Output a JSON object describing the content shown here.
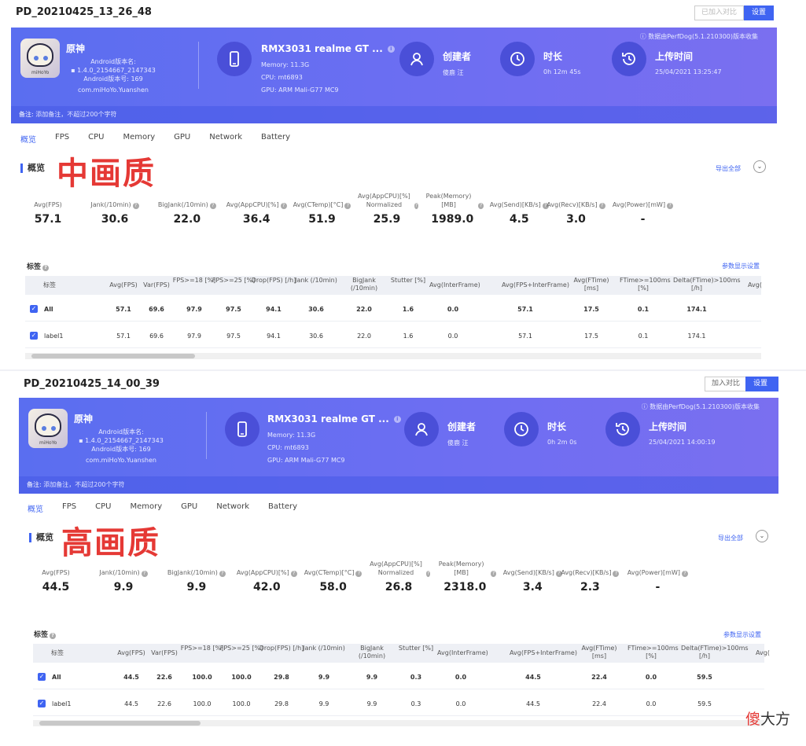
{
  "sessions": [
    {
      "title": "PD_20210425_13_26_48",
      "compare_btn": "已加入对比",
      "settings_btn": "设置",
      "source": "ⓘ 数据由PerfDog(5.1.210300)版本收集",
      "app": {
        "name": "原神",
        "version_label": "Android版本名:",
        "version": "1.4.0_2154667_2147343",
        "version_code": "Android版本号: 169",
        "package": "com.miHoYo.Yuanshen",
        "icon_text": "miHoYo"
      },
      "device": {
        "name": "RMX3031 realme GT ...",
        "memory": "Memory: 11.3G",
        "cpu": "CPU: mt6893",
        "gpu": "GPU: ARM Mali-G77 MC9"
      },
      "creator_label": "创建者",
      "creator": "傻鹿 汪",
      "duration_label": "时长",
      "duration": "0h 12m 45s",
      "upload_label": "上传时间",
      "upload": "25/04/2021 13:25:47",
      "note_label": "备注:",
      "note_placeholder": "添加备注，不超过200个字符",
      "tabs": [
        "概览",
        "FPS",
        "CPU",
        "Memory",
        "GPU",
        "Network",
        "Battery"
      ],
      "overview": "概览",
      "watermark": "中画质",
      "export": "导出全部",
      "metrics": [
        {
          "label": "Avg(FPS)",
          "value": "57.1"
        },
        {
          "label": "Jank(/10min)",
          "value": "30.6"
        },
        {
          "label": "BigJank(/10min)",
          "value": "22.0"
        },
        {
          "label": "Avg(AppCPU)[%]",
          "value": "36.4"
        },
        {
          "label": "Avg(CTemp)[°C]",
          "value": "51.9"
        },
        {
          "label": "Avg(AppCPU)[%] Normalized",
          "value": "25.9"
        },
        {
          "label": "Peak(Memory)[MB]",
          "value": "1989.0"
        },
        {
          "label": "Avg(Send)[KB/s]",
          "value": "4.5"
        },
        {
          "label": "Avg(Recv)[KB/s]",
          "value": "3.0"
        },
        {
          "label": "Avg(Power)[mW]",
          "value": "-"
        }
      ],
      "tags_label": "标签",
      "param_link": "参数显示设置",
      "columns": [
        "标签",
        "Avg(FPS)",
        "Var(FPS)",
        "FPS>=18 [%]",
        "FPS>=25 [%]",
        "Drop(FPS) [/h]",
        "Jank (/10min)",
        "BigJank (/10min)",
        "Stutter [%]",
        "Avg(InterFrame)",
        "Avg(FPS+InterFrame)",
        "Avg(FTime) [ms]",
        "FTime>=100ms [%]",
        "Delta(FTime)>100ms [/h]",
        "Avg("
      ],
      "rows": [
        {
          "label": "All",
          "vals": [
            "57.1",
            "69.6",
            "97.9",
            "97.5",
            "94.1",
            "30.6",
            "22.0",
            "1.6",
            "0.0",
            "57.1",
            "17.5",
            "0.1",
            "174.1"
          ]
        },
        {
          "label": "label1",
          "vals": [
            "57.1",
            "69.6",
            "97.9",
            "97.5",
            "94.1",
            "30.6",
            "22.0",
            "1.6",
            "0.0",
            "57.1",
            "17.5",
            "0.1",
            "174.1"
          ]
        }
      ]
    },
    {
      "title": "PD_20210425_14_00_39",
      "compare_btn": "加入对比",
      "settings_btn": "设置",
      "source": "ⓘ 数据由PerfDog(5.1.210300)版本收集",
      "app": {
        "name": "原神",
        "version_label": "Android版本名:",
        "version": "1.4.0_2154667_2147343",
        "version_code": "Android版本号: 169",
        "package": "com.miHoYo.Yuanshen",
        "icon_text": "miHoYo"
      },
      "device": {
        "name": "RMX3031 realme GT ...",
        "memory": "Memory: 11.3G",
        "cpu": "CPU: mt6893",
        "gpu": "GPU: ARM Mali-G77 MC9"
      },
      "creator_label": "创建者",
      "creator": "傻鹿 汪",
      "duration_label": "时长",
      "duration": "0h 2m 0s",
      "upload_label": "上传时间",
      "upload": "25/04/2021 14:00:19",
      "note_label": "备注:",
      "note_placeholder": "添加备注，不超过200个字符",
      "tabs": [
        "概览",
        "FPS",
        "CPU",
        "Memory",
        "GPU",
        "Network",
        "Battery"
      ],
      "overview": "概览",
      "watermark": "高画质",
      "export": "导出全部",
      "metrics": [
        {
          "label": "Avg(FPS)",
          "value": "44.5"
        },
        {
          "label": "Jank(/10min)",
          "value": "9.9"
        },
        {
          "label": "BigJank(/10min)",
          "value": "9.9"
        },
        {
          "label": "Avg(AppCPU)[%]",
          "value": "42.0"
        },
        {
          "label": "Avg(CTemp)[°C]",
          "value": "58.0"
        },
        {
          "label": "Avg(AppCPU)[%] Normalized",
          "value": "26.8"
        },
        {
          "label": "Peak(Memory)[MB]",
          "value": "2318.0"
        },
        {
          "label": "Avg(Send)[KB/s]",
          "value": "3.4"
        },
        {
          "label": "Avg(Recv)[KB/s]",
          "value": "2.3"
        },
        {
          "label": "Avg(Power)[mW]",
          "value": "-"
        }
      ],
      "tags_label": "标签",
      "param_link": "参数显示设置",
      "columns": [
        "标签",
        "Avg(FPS)",
        "Var(FPS)",
        "FPS>=18 [%]",
        "FPS>=25 [%]",
        "Drop(FPS) [/h]",
        "Jank (/10min)",
        "BigJank (/10min)",
        "Stutter [%]",
        "Avg(InterFrame)",
        "Avg(FPS+InterFrame)",
        "Avg(FTime) [ms]",
        "FTime>=100ms [%]",
        "Delta(FTime)>100ms [/h]",
        "Avg("
      ],
      "rows": [
        {
          "label": "All",
          "vals": [
            "44.5",
            "22.6",
            "100.0",
            "100.0",
            "29.8",
            "9.9",
            "9.9",
            "0.3",
            "0.0",
            "44.5",
            "22.4",
            "0.0",
            "59.5"
          ]
        },
        {
          "label": "label1",
          "vals": [
            "44.5",
            "22.6",
            "100.0",
            "100.0",
            "29.8",
            "9.9",
            "9.9",
            "0.3",
            "0.0",
            "44.5",
            "22.4",
            "0.0",
            "59.5"
          ]
        }
      ]
    }
  ],
  "brand": {
    "part1": "傻",
    "part2": "大方"
  }
}
